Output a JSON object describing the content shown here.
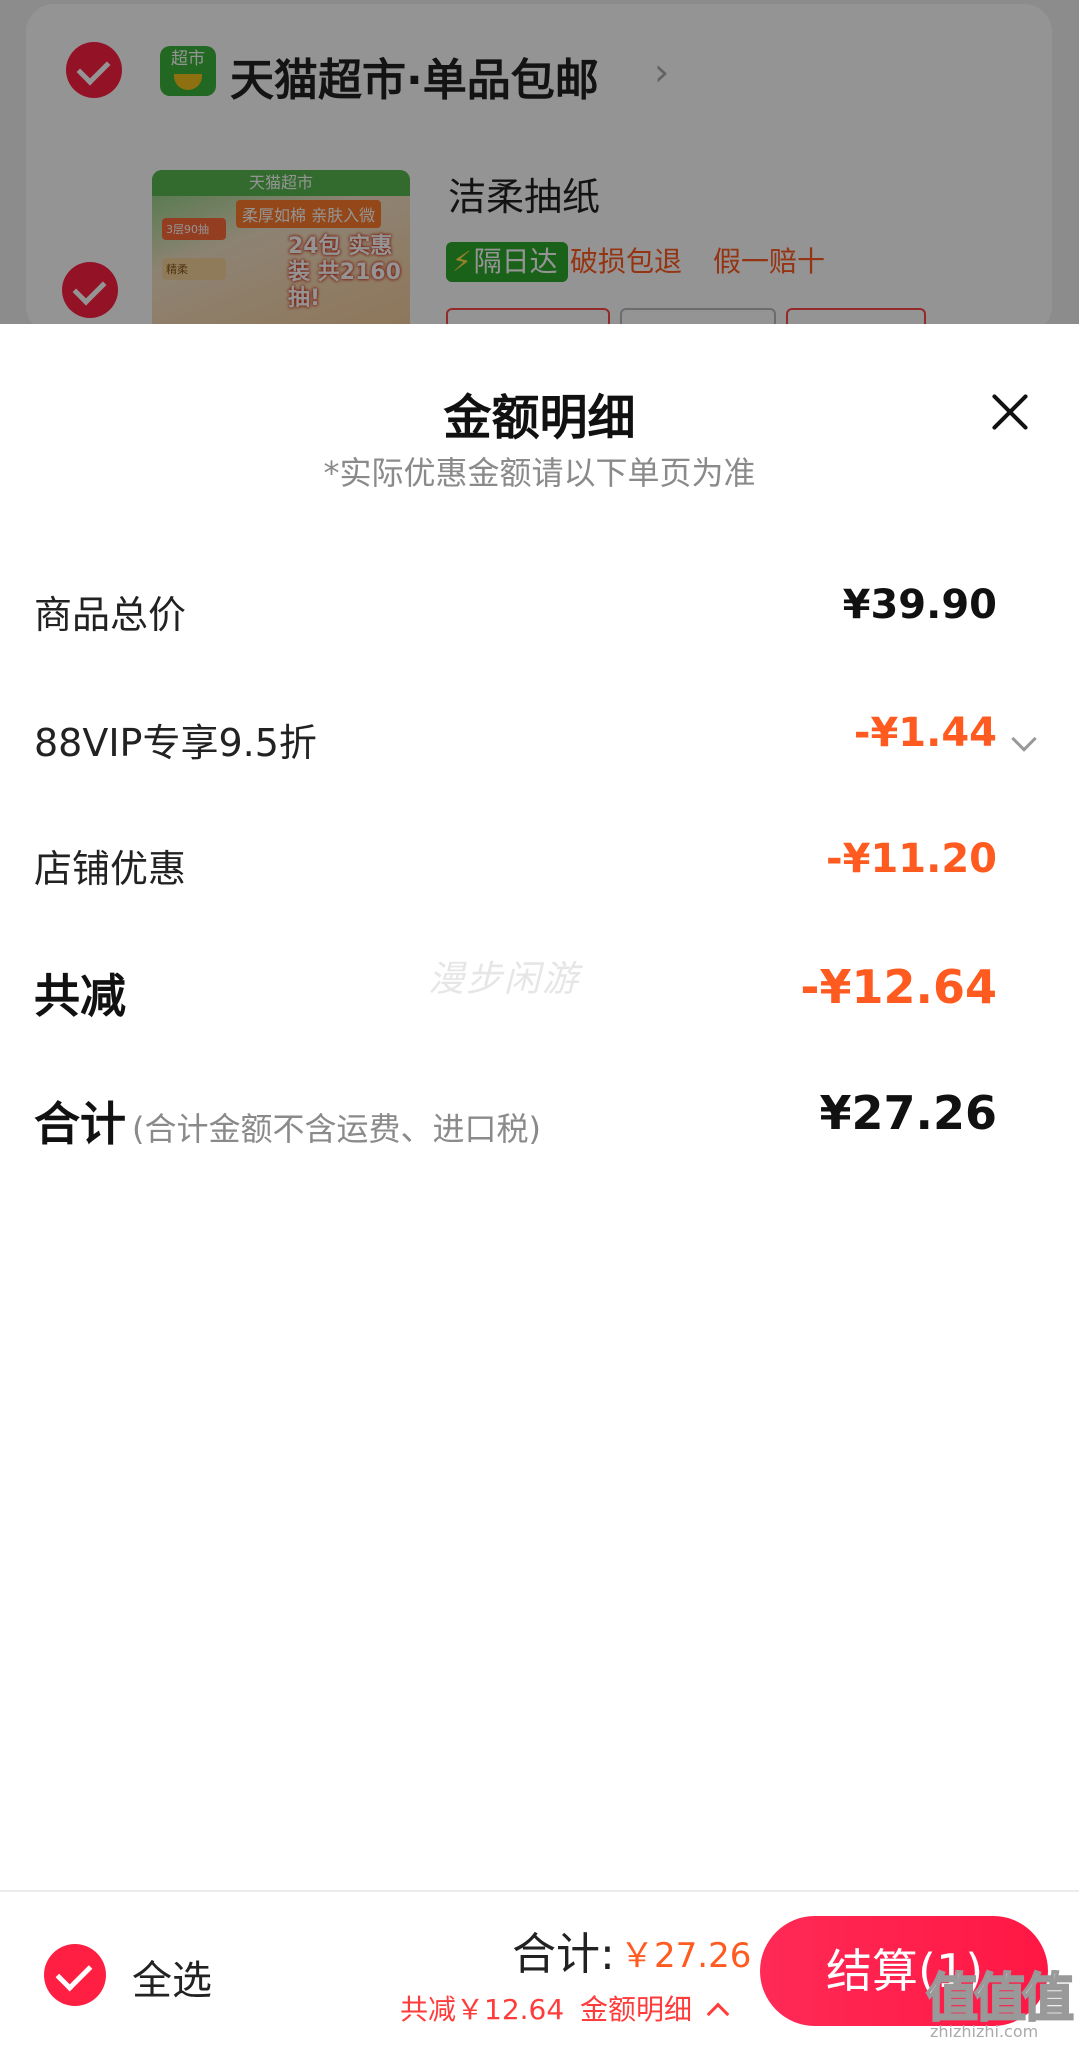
{
  "cart": {
    "store_logo_text": "超市",
    "store_name": "天猫超市·单品包邮",
    "product": {
      "name": "洁柔抽纸",
      "thumb_header": "天猫超市",
      "thumb_tag_top": "柔厚如棉 亲肤入微",
      "thumb_tag_left": "3层90抽",
      "thumb_tag_left2": "精柔",
      "thumb_big_text": "24包 实惠装 共2160抽!",
      "badge_next_day": "隔日达",
      "badge_damage": "破损包退",
      "badge_fake": "假一赔十"
    }
  },
  "sheet": {
    "title": "金额明细",
    "subtitle": "*实际优惠金额请以下单页为准",
    "rows": [
      {
        "label": "商品总价",
        "value": "¥39.90"
      },
      {
        "label": "88VIP专享9.5折",
        "value": "-¥1.44"
      },
      {
        "label": "店铺优惠",
        "value": "-¥11.20"
      },
      {
        "label": "共减",
        "value": "-¥12.64"
      },
      {
        "label": "合计",
        "note": "(合计金额不含运费、进口税)",
        "value": "¥27.26"
      }
    ],
    "watermark": "漫步闲游"
  },
  "bottom_bar": {
    "select_all": "全选",
    "total_label": "合计:",
    "total_value": "￥27.26",
    "discount_text": "共减￥12.64",
    "detail_text": "金额明细",
    "checkout_label": "结算(1)",
    "site_mark": "值值值",
    "site_url": "zhizhizhi.com"
  },
  "colors": {
    "accent_red": "#ff1f43",
    "discount_orange": "#ff5a1f",
    "checkout_start": "#ff2a56",
    "checkout_end": "#ff1744"
  },
  "icons": [
    "check-icon",
    "store-logo-icon",
    "chevron-right-icon",
    "close-icon",
    "chevron-down-icon",
    "chevron-up-icon",
    "lightning-icon"
  ]
}
